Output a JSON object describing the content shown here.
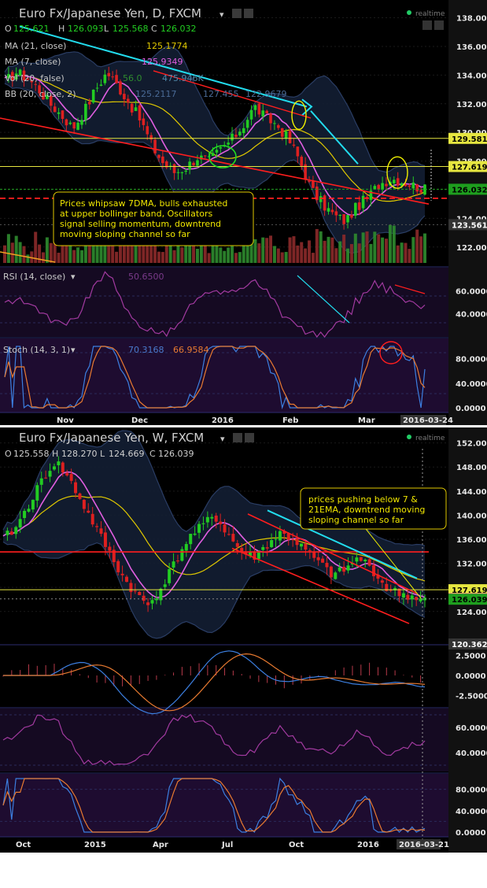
{
  "colors": {
    "bg": "#000000",
    "panel_sub": "#160a22",
    "up": "#22cc22",
    "down": "#dd2020",
    "axis_bg": "#111111",
    "bb": "#2a3d64",
    "ma7": "#e05ee0",
    "ma21": "#e0c800",
    "cyan": "#22dcee",
    "red": "#ff1e1e",
    "yellow": "#f0f000",
    "orange": "#f0a020",
    "green": "#22dd22"
  },
  "daily": {
    "title": "Euro Fx/Japanese Yen, D, FXCM",
    "status": "realtime",
    "ohlc": {
      "o_label": "O",
      "o": "125.621",
      "h_label": "H",
      "h": "126.093",
      "l_label": "L",
      "l": "125.568",
      "c_label": "C",
      "c": "126.032"
    },
    "indicators": [
      {
        "name": "MA (21, close)",
        "value": "125.1774"
      },
      {
        "name": "MA (7, close)",
        "value": "125.9349"
      },
      {
        "name": "Vol (20, false)",
        "value": "56.0",
        "value2": "475.946K"
      },
      {
        "name": "BB (20, close, 2)",
        "value": "125.2117",
        "value2": "127.455",
        "value3": "122.9679"
      }
    ],
    "annotation": [
      "Prices whipsaw 7DMA, bulls exhausted",
      "at upper bollinger band, Oscillators",
      "signal selling momentum, downtrend",
      "moving sloping channel so far"
    ],
    "y_ticks": [
      "138.000",
      "136.000",
      "134.000",
      "132.000",
      "130.000",
      "128.000",
      "126.000",
      "124.000",
      "122.000"
    ],
    "price_tags": [
      "129.581",
      "127.619",
      "126.032",
      "123.561"
    ],
    "x_ticks": [
      "Nov",
      "Dec",
      "2016",
      "Feb",
      "Mar"
    ],
    "date_tag": "2016-03-24",
    "rsi": {
      "label": "RSI (14, close)",
      "value": "50.6500",
      "ticks": [
        "60.0000",
        "40.0000"
      ]
    },
    "stoch": {
      "label": "Stoch (14, 3, 1)",
      "value": "70.3168",
      "value2": "66.9584",
      "ticks": [
        "80.0000",
        "40.0000",
        "0.0000"
      ]
    }
  },
  "weekly": {
    "title": "Euro Fx/Japanese Yen, W, FXCM",
    "status": "realtime",
    "ohlc": {
      "o_label": "O",
      "o": "125.558",
      "h_label": "H",
      "h": "128.270",
      "l_label": "L",
      "l": "124.669",
      "c_label": "C",
      "c": "126.039"
    },
    "annotation": [
      "prices pushing below 7 &",
      "21EMA, downtrend moving",
      "sloping channel so far"
    ],
    "y_ticks": [
      "152.000",
      "148.000",
      "144.000",
      "140.000",
      "136.000",
      "132.000",
      "128.000",
      "124.000"
    ],
    "price_tags": [
      "127.619",
      "126.101",
      "126.039",
      "120.362"
    ],
    "x_ticks": [
      "Oct",
      "2015",
      "Apr",
      "Jul",
      "Oct",
      "2016"
    ],
    "date_tag": "2016-03-21",
    "macd_ticks": [
      "2.5000",
      "0.0000",
      "-2.5000"
    ],
    "rsi_ticks": [
      "60.0000",
      "40.0000"
    ],
    "stoch_ticks": [
      "80.0000",
      "40.0000",
      "0.0000"
    ]
  },
  "chart_data": [
    {
      "type": "candlestick",
      "title": "Euro Fx/Japanese Yen, D, FXCM",
      "timeframe": "D",
      "x_ticks": [
        "Nov",
        "Dec",
        "2016",
        "Feb",
        "Mar"
      ],
      "ylim": [
        121,
        138
      ],
      "close_points": [
        133.5,
        134.2,
        133.8,
        133.0,
        132.0,
        131.2,
        130.3,
        131.5,
        133.0,
        134.2,
        133.2,
        132.0,
        130.8,
        129.0,
        127.8,
        127.2,
        127.6,
        128.3,
        128.0,
        128.8,
        129.5,
        130.5,
        131.8,
        131.0,
        130.5,
        129.5,
        128.0,
        126.0,
        125.0,
        124.2,
        123.8,
        124.8,
        125.5,
        126.4,
        126.8,
        126.6,
        126.3,
        126.0
      ],
      "last": {
        "open": 125.621,
        "high": 126.093,
        "low": 125.568,
        "close": 126.032
      },
      "indicators": {
        "ma21": 125.1774,
        "ma7": 125.9349,
        "bb": [
          125.2117,
          127.455,
          122.9679
        ]
      },
      "levels": [
        129.581,
        127.619,
        126.032,
        123.561
      ],
      "rsi": {
        "value": 50.65,
        "ylim": [
          20,
          80
        ]
      },
      "stoch": {
        "k": 70.3168,
        "d": 66.9584,
        "ylim": [
          0,
          100
        ]
      }
    },
    {
      "type": "candlestick",
      "title": "Euro Fx/Japanese Yen, W, FXCM",
      "timeframe": "W",
      "x_ticks": [
        "Oct",
        "2015",
        "Apr",
        "Jul",
        "Oct",
        "2016"
      ],
      "ylim": [
        120,
        152
      ],
      "close_points": [
        136,
        138,
        142,
        146,
        149,
        146,
        142,
        138,
        134,
        130,
        127,
        125,
        128,
        132,
        136,
        138,
        140,
        137,
        134,
        133,
        135,
        137,
        136,
        134,
        132,
        130,
        131,
        133,
        131,
        128,
        127,
        126.5,
        126
      ],
      "last": {
        "open": 125.558,
        "high": 128.27,
        "low": 124.669,
        "close": 126.039
      },
      "levels": [
        127.619,
        126.101,
        126.039,
        120.362
      ],
      "macd_ylim": [
        -3.5,
        3.5
      ],
      "rsi_ylim": [
        25,
        75
      ],
      "stoch_ylim": [
        0,
        100
      ]
    }
  ]
}
